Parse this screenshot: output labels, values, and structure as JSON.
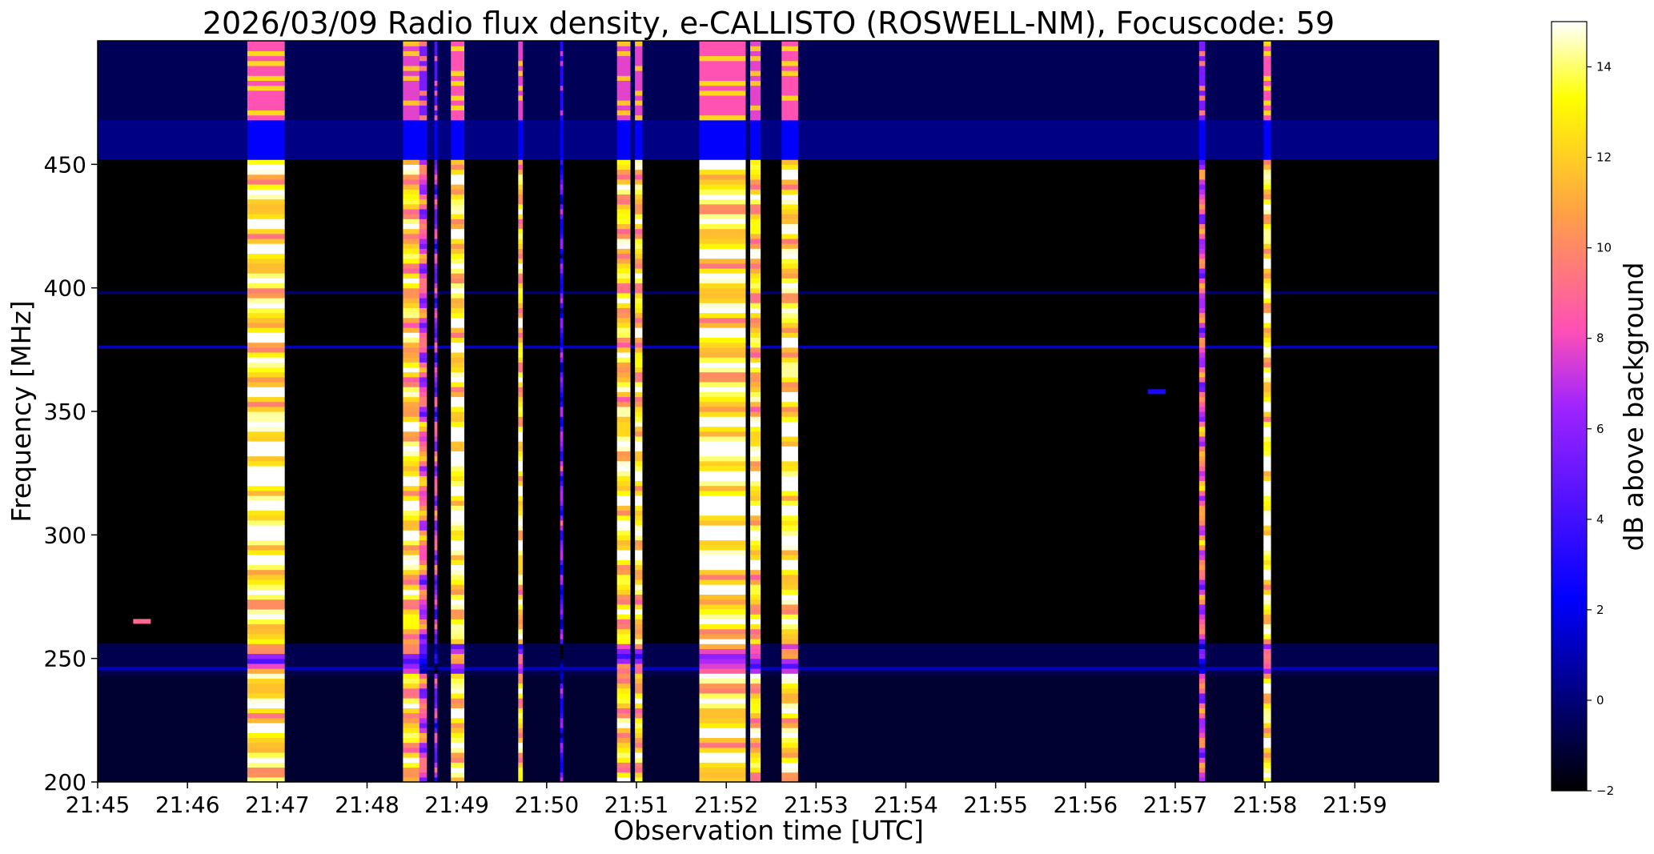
{
  "chart_data": {
    "type": "heatmap",
    "title": "2026/03/09  Radio flux density, e-CALLISTO (ROSWELL-NM), Focuscode: 59",
    "xlabel": "Observation time [UTC]",
    "ylabel": "Frequency [MHz]",
    "colorbar_label": "dB above background",
    "colormap": "gnuplot2",
    "x_range": [
      "21:45:00",
      "21:59:56"
    ],
    "x_ticks": [
      "21:45",
      "21:46",
      "21:47",
      "21:48",
      "21:49",
      "21:50",
      "21:51",
      "21:52",
      "21:53",
      "21:54",
      "21:55",
      "21:56",
      "21:57",
      "21:58",
      "21:59"
    ],
    "ylim": [
      200,
      500
    ],
    "y_ticks": [
      200,
      250,
      300,
      350,
      400,
      450
    ],
    "clim": [
      -2,
      15
    ],
    "colorbar_ticks": [
      -2,
      0,
      2,
      4,
      6,
      8,
      10,
      12,
      14
    ],
    "grid": false,
    "background_bands_mhz": [
      {
        "from": 452,
        "to": 468,
        "level_db": 2.0
      },
      {
        "from": 468,
        "to": 500,
        "level_db": 0.6
      },
      {
        "from": 243,
        "to": 256,
        "level_db": 0.4
      },
      {
        "from": 200,
        "to": 243,
        "level_db": -0.5
      }
    ],
    "narrowband_lines_mhz": [
      {
        "freq": 376,
        "level_db": 2.5
      },
      {
        "freq": 398,
        "level_db": 0.3
      },
      {
        "freq": 246,
        "level_db": 2.0
      }
    ],
    "broadband_bursts": [
      {
        "start": "21:46:40",
        "end": "21:47:05",
        "peak_db": 15
      },
      {
        "start": "21:48:24",
        "end": "21:48:35",
        "peak_db": 14
      },
      {
        "start": "21:48:35",
        "end": "21:48:40",
        "peak_db": 10
      },
      {
        "start": "21:48:45",
        "end": "21:48:47",
        "peak_db": 8
      },
      {
        "start": "21:48:56",
        "end": "21:49:05",
        "peak_db": 15
      },
      {
        "start": "21:49:41",
        "end": "21:49:44",
        "peak_db": 14
      },
      {
        "start": "21:50:09",
        "end": "21:50:11",
        "peak_db": 6
      },
      {
        "start": "21:50:47",
        "end": "21:50:56",
        "peak_db": 14
      },
      {
        "start": "21:50:59",
        "end": "21:51:04",
        "peak_db": 14
      },
      {
        "start": "21:51:42",
        "end": "21:52:13",
        "peak_db": 15
      },
      {
        "start": "21:52:16",
        "end": "21:52:23",
        "peak_db": 14
      },
      {
        "start": "21:52:37",
        "end": "21:52:48",
        "peak_db": 15
      },
      {
        "start": "21:57:16",
        "end": "21:57:20",
        "peak_db": 10
      },
      {
        "start": "21:57:59",
        "end": "21:58:04",
        "peak_db": 15
      }
    ],
    "weak_blips": [
      {
        "time": "21:45:28",
        "freq": 265,
        "level_db": 9
      },
      {
        "time": "21:56:46",
        "freq": 358,
        "level_db": 3
      }
    ]
  }
}
